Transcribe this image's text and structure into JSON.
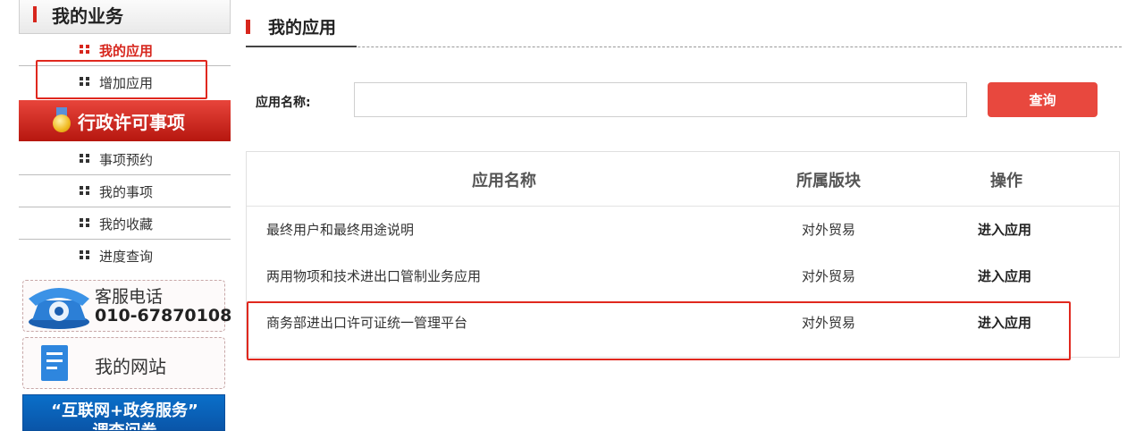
{
  "sidebar": {
    "business_title": "我的业务",
    "business_items": [
      {
        "label": "我的应用",
        "active": true
      },
      {
        "label": "增加应用",
        "active": false
      }
    ],
    "admin_banner": "行政许可事项",
    "admin_items": [
      {
        "label": "事项预约"
      },
      {
        "label": "我的事项"
      },
      {
        "label": "我的收藏"
      },
      {
        "label": "进度查询"
      }
    ],
    "service_phone": {
      "label": "客服电话",
      "number": "010-67870108"
    },
    "my_site": "我的网站",
    "survey": {
      "line1": "“互联网+政务服务”",
      "line2": "调查问卷"
    }
  },
  "main": {
    "page_title": "我的应用",
    "search": {
      "label": "应用名称:",
      "value": "",
      "placeholder": "",
      "button": "查询"
    },
    "table": {
      "headers": [
        "应用名称",
        "所属版块",
        "操作"
      ],
      "rows": [
        {
          "name": "最终用户和最终用途说明",
          "section": "对外贸易",
          "action": "进入应用"
        },
        {
          "name": "两用物项和技术进出口管制业务应用",
          "section": "对外贸易",
          "action": "进入应用"
        },
        {
          "name": "商务部进出口许可证统一管理平台",
          "section": "对外贸易",
          "action": "进入应用"
        }
      ]
    }
  },
  "colors": {
    "accent_red": "#d7261d",
    "button_red": "#e8483e",
    "highlight_box": "#e0281e",
    "survey_blue": "#0a6fc9"
  },
  "icons": [
    "dots-icon",
    "medal-icon",
    "phone-icon",
    "document-icon"
  ]
}
